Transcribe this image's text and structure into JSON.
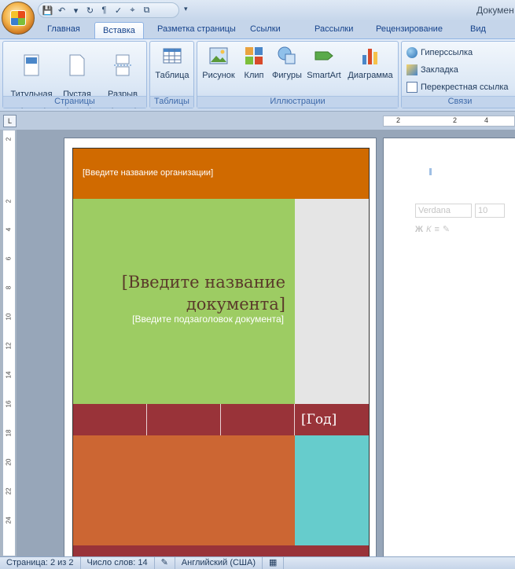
{
  "window": {
    "title": "Докумен"
  },
  "tabs": [
    "Главная",
    "Вставка",
    "Разметка страницы",
    "Ссылки",
    "Рассылки",
    "Рецензирование",
    "Вид"
  ],
  "ribbon": {
    "pages": {
      "label": "Страницы",
      "cover": "Титульная\nстраница",
      "blank": "Пустая\nстраница",
      "break": "Разрыв\nстраницы"
    },
    "tables": {
      "label": "Таблицы",
      "table": "Таблица"
    },
    "illustrations": {
      "label": "Иллюстрации",
      "picture": "Рисунок",
      "clip": "Клип",
      "shapes": "Фигуры",
      "smartart": "SmartArt",
      "chart": "Диаграмма"
    },
    "links": {
      "label": "Связи",
      "hyperlink": "Гиперссылка",
      "bookmark": "Закладка",
      "crossref": "Перекрестная ссылка"
    }
  },
  "hruler": [
    "2",
    "2",
    "4"
  ],
  "vruler": [
    "2",
    "2",
    "4",
    "6",
    "8",
    "10",
    "12",
    "14",
    "16",
    "18",
    "20",
    "22",
    "24"
  ],
  "cover": {
    "org": "[Введите название организации]",
    "title": "[Введите название документа]",
    "subtitle": "[Введите подзаголовок документа]",
    "year": "[Год]"
  },
  "minitoolbar": {
    "font": "Verdana",
    "size": "10",
    "bold": "Ж",
    "italic": "К"
  },
  "status": {
    "page": "Страница: 2 из 2",
    "words": "Число слов: 14",
    "lang": "Английский (США)"
  },
  "colors": {
    "orange": "#d06a00",
    "green": "#9dcc63",
    "maroon": "#993339",
    "teal": "#66cccc",
    "rust": "#cc6633"
  }
}
